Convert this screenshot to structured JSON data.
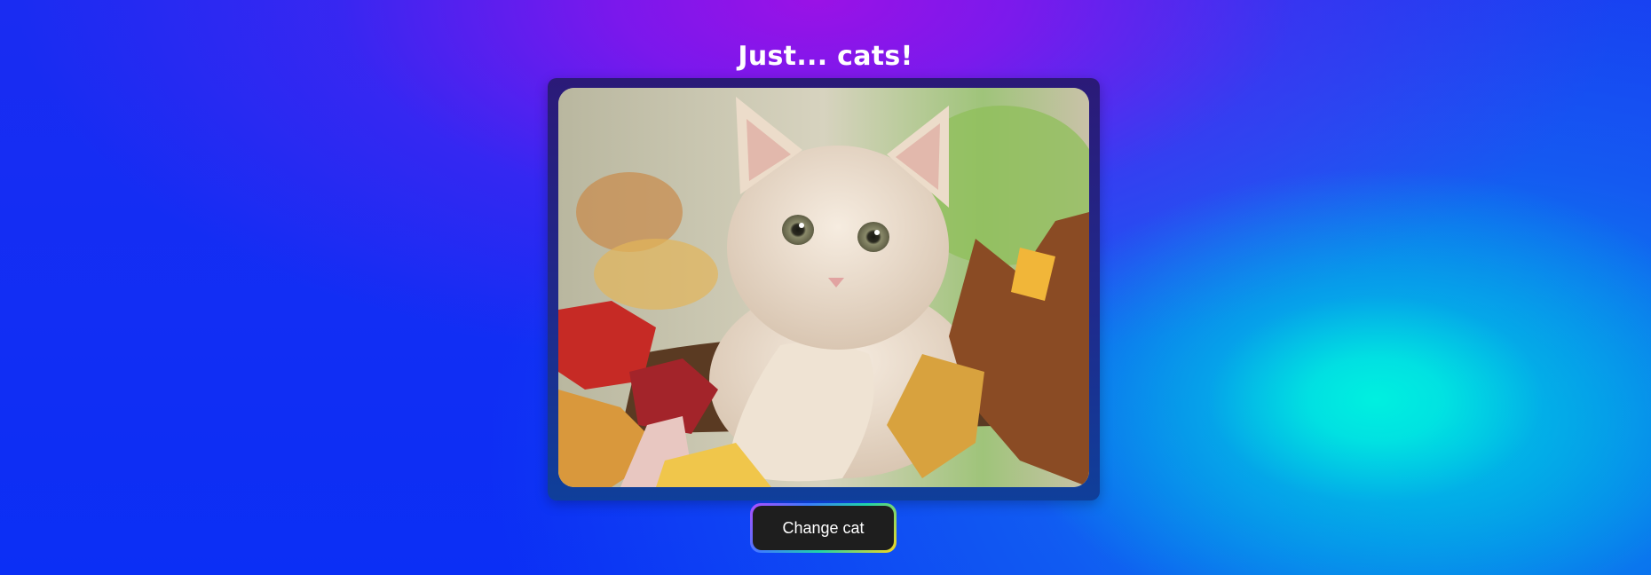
{
  "page": {
    "title": "Just... cats!"
  },
  "image": {
    "subject": "cat-photo"
  },
  "actions": {
    "change_label": "Change cat"
  },
  "colors": {
    "frame": "#1f2a8c",
    "button_bg": "#1e1e1e",
    "title_text": "#ffffff"
  }
}
